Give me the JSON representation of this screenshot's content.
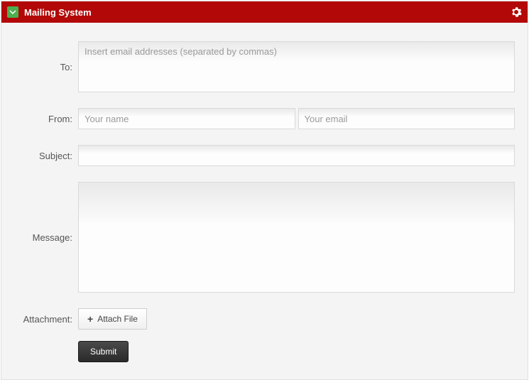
{
  "header": {
    "title": "Mailing System"
  },
  "form": {
    "to": {
      "label": "To:",
      "placeholder": "Insert email addresses (separated by commas)",
      "value": ""
    },
    "from": {
      "label": "From:",
      "name_placeholder": "Your name",
      "name_value": "",
      "email_placeholder": "Your email",
      "email_value": ""
    },
    "subject": {
      "label": "Subject:",
      "value": ""
    },
    "message": {
      "label": "Message:",
      "value": ""
    },
    "attachment": {
      "label": "Attachment:",
      "button_label": "Attach File"
    },
    "submit_label": "Submit"
  },
  "icons": {
    "collapse": "chevron-down-icon",
    "settings": "gear-icon",
    "plus": "plus-icon"
  }
}
